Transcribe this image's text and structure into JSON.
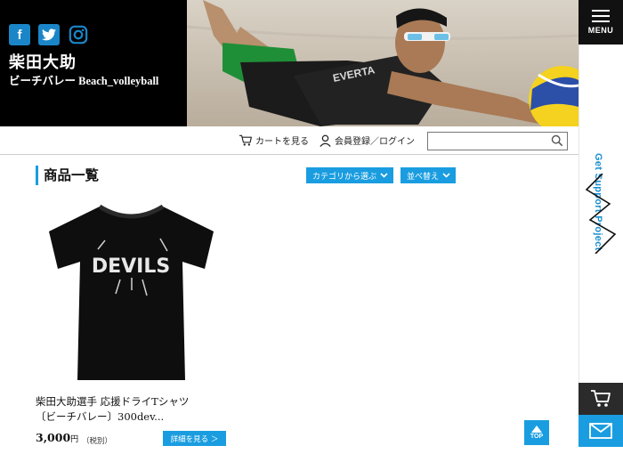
{
  "brand": {
    "name": "柴田大助",
    "subtitle": "ビーチバレー Beach_volleyball"
  },
  "social": {
    "facebook_glyph": "f",
    "icons": [
      "facebook-icon",
      "twitter-icon",
      "instagram-icon"
    ]
  },
  "hero": {
    "shirt_text": "EVERTA"
  },
  "menu": {
    "label": "MENU"
  },
  "side_rail": {
    "project_text": "Get Support Project"
  },
  "utility": {
    "cart_label": "カートを見る",
    "member_label": "会員登録／ログイン",
    "search_value": "",
    "search_placeholder": ""
  },
  "content": {
    "section_title": "商品一覧",
    "category_button": "カテゴリから選ぶ",
    "sort_button": "並べ替え"
  },
  "product": {
    "image_text": "DEVILS",
    "name_line1": "柴田大助選手 応援ドライTシャツ",
    "name_line2": "〔ビーチバレー〕300dev...",
    "price": "3,000",
    "price_unit": "円",
    "price_note": "（税別）",
    "detail_button": "詳細を見る ＞"
  },
  "top_button": {
    "label": "TOP"
  },
  "colors": {
    "accent": "#1a9de0",
    "dark": "#000000",
    "rail_cart": "#2b2b2b"
  }
}
